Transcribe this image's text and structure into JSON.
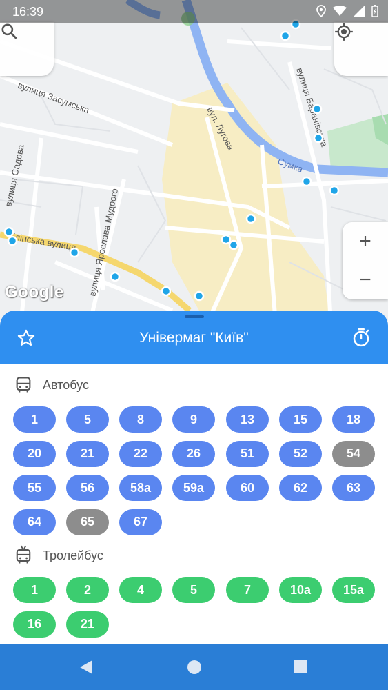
{
  "status_bar": {
    "time": "16:39",
    "icons": [
      "location-icon",
      "wifi-icon",
      "signal-icon",
      "battery-icon"
    ]
  },
  "map": {
    "logo": "Google",
    "street_labels": [
      "вулиця Засумська",
      "вул. Лугова",
      "вулиця Садова",
      "вулиця Ярослава Мудрого",
      "Сумка",
      "вулиця Баранівська",
      "ілінська вулиця"
    ],
    "zoom_in": "+",
    "zoom_out": "−"
  },
  "stop": {
    "name": "Універмаг \"Київ\""
  },
  "bus": {
    "label": "Автобус",
    "routes": [
      {
        "n": "1",
        "active": true
      },
      {
        "n": "5",
        "active": true
      },
      {
        "n": "8",
        "active": true
      },
      {
        "n": "9",
        "active": true
      },
      {
        "n": "13",
        "active": true
      },
      {
        "n": "15",
        "active": true
      },
      {
        "n": "18",
        "active": true
      },
      {
        "n": "20",
        "active": true
      },
      {
        "n": "21",
        "active": true
      },
      {
        "n": "22",
        "active": true
      },
      {
        "n": "26",
        "active": true
      },
      {
        "n": "51",
        "active": true
      },
      {
        "n": "52",
        "active": true
      },
      {
        "n": "54",
        "active": false
      },
      {
        "n": "55",
        "active": true
      },
      {
        "n": "56",
        "active": true
      },
      {
        "n": "58а",
        "active": true
      },
      {
        "n": "59а",
        "active": true
      },
      {
        "n": "60",
        "active": true
      },
      {
        "n": "62",
        "active": true
      },
      {
        "n": "63",
        "active": true
      },
      {
        "n": "64",
        "active": true
      },
      {
        "n": "65",
        "active": false
      },
      {
        "n": "67",
        "active": true
      }
    ]
  },
  "trolleybus": {
    "label": "Тролейбус",
    "routes": [
      {
        "n": "1",
        "active": true
      },
      {
        "n": "2",
        "active": true
      },
      {
        "n": "4",
        "active": true
      },
      {
        "n": "5",
        "active": true
      },
      {
        "n": "7",
        "active": true
      },
      {
        "n": "10а",
        "active": true
      },
      {
        "n": "15а",
        "active": true
      },
      {
        "n": "16",
        "active": true
      },
      {
        "n": "21",
        "active": true
      }
    ]
  },
  "colors": {
    "header": "#2f8ff0",
    "bus_chip": "#5a86f0",
    "trolley_chip": "#3ccd70",
    "inactive_chip": "#8d8d8d",
    "navbar": "#2a7ed6"
  }
}
